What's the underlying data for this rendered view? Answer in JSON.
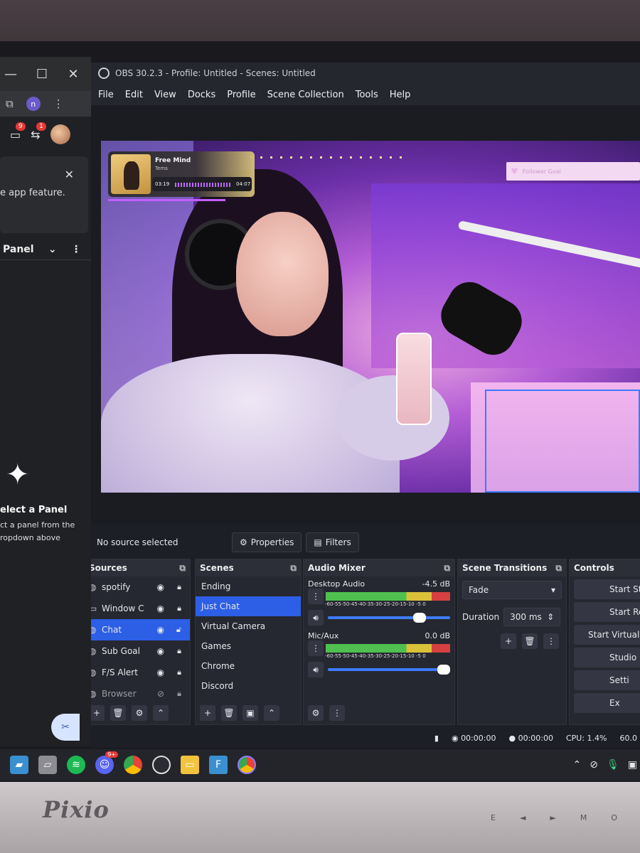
{
  "browser": {
    "window_controls": [
      "—",
      "☐",
      "✕"
    ],
    "badges": {
      "folder": "9",
      "share": "1"
    },
    "avatar_letter": "n",
    "notice_text": "e app feature.",
    "panel_label": "Panel",
    "select_heading": "elect a Panel",
    "select_sub": "ct a panel from the ropdown above"
  },
  "obs": {
    "title": "OBS 30.2.3 - Profile: Untitled - Scenes: Untitled",
    "menu": [
      "File",
      "Edit",
      "View",
      "Docks",
      "Profile",
      "Scene Collection",
      "Tools",
      "Help"
    ],
    "now_playing": {
      "title": "Free Mind",
      "artist": "Tems",
      "elapsed": "03:19",
      "total": "04:07"
    },
    "follower_goal": "Follower Goal",
    "source_bar": {
      "status": "No source selected",
      "properties": "Properties",
      "filters": "Filters"
    },
    "sources": {
      "title": "Sources",
      "items": [
        {
          "name": "spotify",
          "icon": "globe-icon"
        },
        {
          "name": "Window C",
          "icon": "window-icon"
        },
        {
          "name": "Chat",
          "icon": "globe-icon",
          "selected": true
        },
        {
          "name": "Sub Goal",
          "icon": "globe-icon"
        },
        {
          "name": "F/S Alert",
          "icon": "globe-icon"
        },
        {
          "name": "Browser",
          "icon": "globe-icon",
          "hidden": true
        }
      ]
    },
    "scenes": {
      "title": "Scenes",
      "items": [
        "Ending",
        "Just Chat",
        "Virtual Camera",
        "Games",
        "Chrome",
        "Discord"
      ],
      "selected": "Just Chat"
    },
    "audio_mixer": {
      "title": "Audio Mixer",
      "channels": [
        {
          "name": "Desktop Audio",
          "db": "-4.5 dB",
          "volume_fraction": 0.8
        },
        {
          "name": "Mic/Aux",
          "db": "0.0 dB",
          "volume_fraction": 1.0
        }
      ],
      "ticks": "-60-55-50-45-40-35-30-25-20-15-10 -5  0"
    },
    "transitions": {
      "title": "Scene Transitions",
      "type": "Fade",
      "duration_label": "Duration",
      "duration": "300 ms"
    },
    "controls": {
      "title": "Controls",
      "buttons": [
        "Start Str",
        "Start Re",
        "Start Virtual C",
        "Studio",
        "Setti",
        "Ex"
      ]
    },
    "status": {
      "rec_time": "00:00:00",
      "stream_time": "00:00:00",
      "cpu": "CPU: 1.4%",
      "fps": "60.0"
    }
  },
  "taskbar": {
    "discord_badge": "9+"
  },
  "monitor": {
    "brand": "Pixio",
    "buttons": [
      "E",
      "◄",
      "►",
      "M",
      "O"
    ]
  }
}
